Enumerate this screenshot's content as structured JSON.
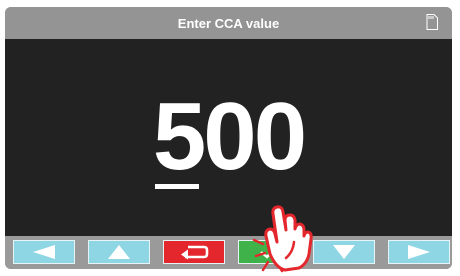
{
  "header": {
    "title": "Enter CCA value",
    "sd_card_icon": "sd-card-icon"
  },
  "display": {
    "cursor_digit": "5",
    "rest_digits": "00",
    "value": 500
  },
  "buttons": [
    {
      "name": "left-button",
      "icon": "arrow-left-icon",
      "color": "#8fd6e4"
    },
    {
      "name": "up-button",
      "icon": "arrow-up-icon",
      "color": "#8fd6e4"
    },
    {
      "name": "back-button",
      "icon": "return-icon",
      "color": "#e3272d"
    },
    {
      "name": "enter-button",
      "icon": "check-icon",
      "color": "#3fb34a"
    },
    {
      "name": "down-button",
      "icon": "arrow-down-icon",
      "color": "#8fd6e4"
    },
    {
      "name": "right-button",
      "icon": "arrow-right-icon",
      "color": "#8fd6e4"
    }
  ],
  "pointer": {
    "icon": "tap-hand-icon",
    "target": "enter-button"
  }
}
